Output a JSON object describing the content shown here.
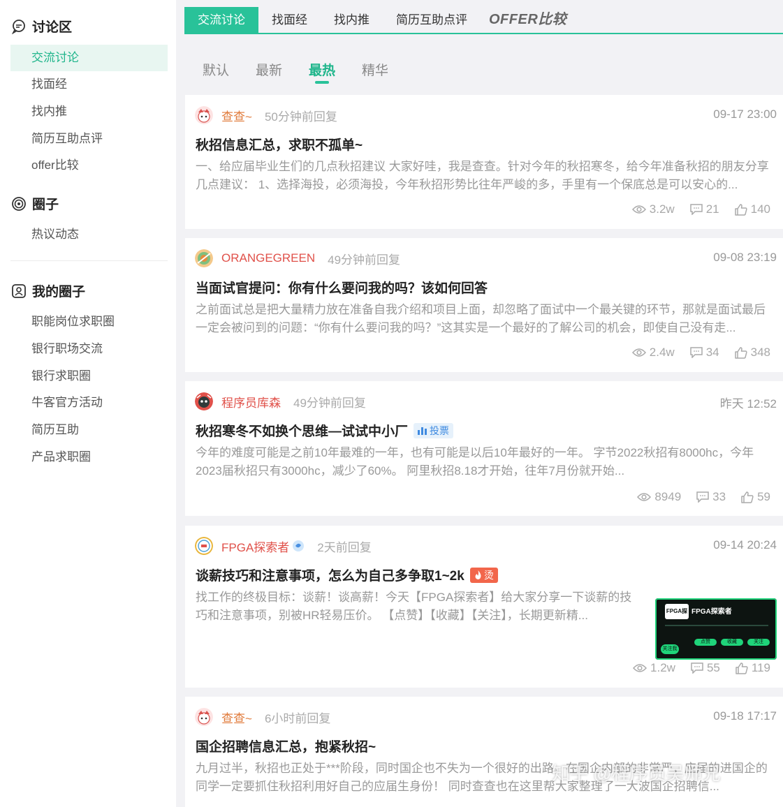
{
  "sidebar": {
    "discussion_title": "讨论区",
    "discussion_items": [
      "交流讨论",
      "找面经",
      "找内推",
      "简历互助点评",
      "offer比较"
    ],
    "circle_title": "圈子",
    "circle_items": [
      "热议动态"
    ],
    "my_circle_title": "我的圈子",
    "my_circle_items": [
      "职能岗位求职圈",
      "银行职场交流",
      "银行求职圈",
      "牛客官方活动",
      "简历互助",
      "产品求职圈"
    ]
  },
  "tabs": [
    "交流讨论",
    "找面经",
    "找内推",
    "简历互助点评",
    "OFFER比较"
  ],
  "subtabs": [
    "默认",
    "最新",
    "最热",
    "精华"
  ],
  "posts": [
    {
      "user": "查查~",
      "replied": "50分钟前回复",
      "date": "09-17 23:00",
      "title": "秋招信息汇总，求职不孤单~",
      "excerpt": "一、给应届毕业生们的几点秋招建议 大家好哇，我是查查。针对今年的秋招寒冬，给今年准备秋招的朋友分享几点建议： 1、选择海投，必须海投，今年秋招形势比往年严峻的多，手里有一个保底总是可以安心的...",
      "views": "3.2w",
      "comments": "21",
      "likes": "140"
    },
    {
      "user": "ORANGEGREEN",
      "replied": "49分钟前回复",
      "date": "09-08 23:19",
      "title": "当面试官提问：你有什么要问我的吗？该如何回答",
      "excerpt": "之前面试总是把大量精力放在准备自我介绍和项目上面，却忽略了面试中一个最关键的环节，那就是面试最后一定会被问到的问题：“你有什么要问我的吗？”这其实是一个最好的了解公司的机会，即使自己没有走...",
      "views": "2.4w",
      "comments": "34",
      "likes": "348"
    },
    {
      "user": "程序员库森",
      "replied": "49分钟前回复",
      "date": "昨天 12:52",
      "title": "秋招寒冬不如换个思维—试试中小厂",
      "badge": "投票",
      "excerpt": "今年的难度可能是之前10年最难的一年，也有可能是以后10年最好的一年。 字节2022秋招有8000hc，今年2023届秋招只有3000hc，减少了60%。 阿里秋招8.18才开始，往年7月份就开始...",
      "views": "8949",
      "comments": "33",
      "likes": "59"
    },
    {
      "user": "FPGA探索者",
      "replied": "2天前回复",
      "date": "09-14 20:24",
      "title": "谈薪技巧和注意事项，怎么为自己多争取1~2k",
      "badge": "烫",
      "excerpt": "找工作的终极目标：谈薪！谈高薪！今天【FPGA探索者】给大家分享一下谈薪的技巧和注意事项，别被HR轻易压价。 【点赞】【收藏】【关注】，长期更新精...",
      "thumb_label": "FPGA探索者",
      "thumb_logo": "FPGA探索者",
      "thumb_chips": [
        "点赞",
        "收藏",
        "关注"
      ],
      "thumb_tag": "关注我",
      "views": "1.2w",
      "comments": "55",
      "likes": "119"
    },
    {
      "user": "查查~",
      "replied": "6小时前回复",
      "date": "09-18 17:17",
      "title": "国企招聘信息汇总，抱紧秋招~",
      "excerpt": "九月过半，秋招也正处于***阶段，同时国企也不失为一个很好的出路，在国企内部的非常严，应届的进国企的同学一定要抓住秋招利用好自己的应届生身份！ 同时查查也在这里帮大家整理了一大波国企招聘信..."
    }
  ],
  "watermark": "知乎 @程序员吴师兄",
  "colors": {
    "accent": "#29c299",
    "accent_text": "#1fb58b",
    "user_orange": "#e07a3a",
    "user_red": "#e0514a"
  }
}
